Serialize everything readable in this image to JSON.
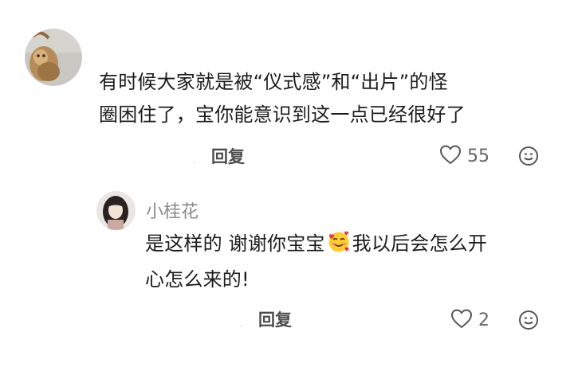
{
  "comment": {
    "avatar": "cat-avatar",
    "text_line1": "有时候大家就是被“仪式感”和“出片”的怪",
    "text_line2": "圈困住了，宝你能意识到这一点已经很好了",
    "reply_label": "回复",
    "like_count": "55",
    "like_icon": "heart-outline-icon",
    "emoji_icon": "smiley-icon"
  },
  "reply": {
    "avatar": "girl-avatar",
    "username": "小桂花",
    "text_part1": "是这样的 谢谢你宝宝",
    "inline_emoji": "smiling-face-with-hearts",
    "text_part2": "我以后会怎么开",
    "text_line2": "心怎么来的!",
    "reply_label": "回复",
    "like_count": "2",
    "like_icon": "heart-outline-icon",
    "emoji_icon": "smiley-icon"
  }
}
